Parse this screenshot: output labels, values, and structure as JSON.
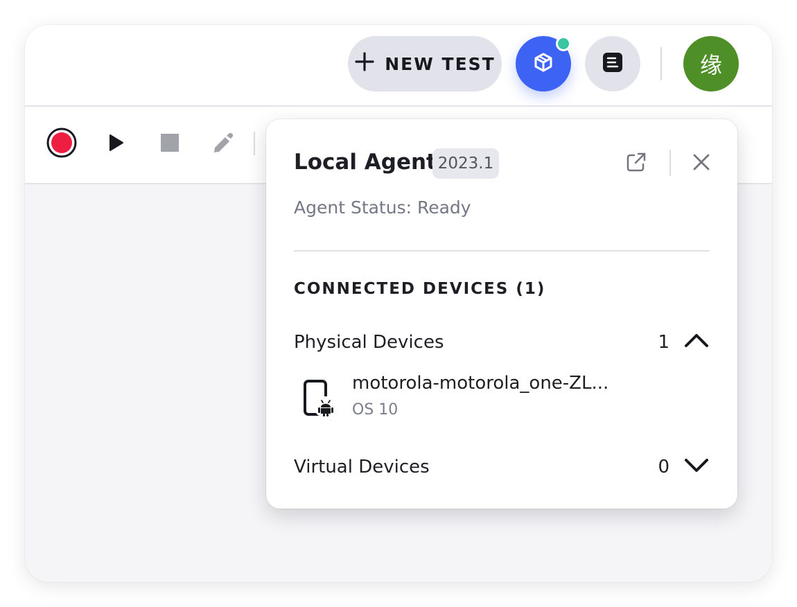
{
  "topbar": {
    "new_test_label": "NEW TEST",
    "plus_icon": "plus-icon",
    "agent_icon": "cube-icon",
    "notes_icon": "notes-icon",
    "avatar_text": "缘",
    "accent_color": "#3d63f4",
    "status_dot_color": "#39c5a2",
    "avatar_color": "#4e8f28"
  },
  "toolbar": {
    "record_icon": "record-icon",
    "play_icon": "play-icon",
    "stop_icon": "stop-icon",
    "edit_icon": "edit-pen-icon"
  },
  "agent_popover": {
    "title": "Local Agent",
    "version": "2023.1",
    "status": "Agent Status: Ready",
    "connected_heading": "CONNECTED DEVICES (1)",
    "physical": {
      "label": "Physical Devices",
      "count": "1",
      "expanded": true,
      "devices": [
        {
          "name": "motorola-motorola_one-ZL...",
          "os": "OS 10"
        }
      ]
    },
    "virtual": {
      "label": "Virtual Devices",
      "count": "0",
      "expanded": false
    }
  }
}
